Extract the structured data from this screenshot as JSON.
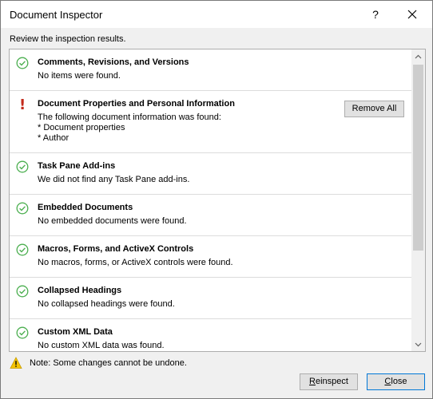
{
  "window": {
    "title": "Document Inspector",
    "help_glyph": "?"
  },
  "instruction": "Review the inspection results.",
  "results": [
    {
      "status": "ok",
      "title": "Comments, Revisions, and Versions",
      "description": "No items were found."
    },
    {
      "status": "found",
      "title": "Document Properties and Personal Information",
      "description": "The following document information was found:\n* Document properties\n* Author",
      "action_label": "Remove All"
    },
    {
      "status": "ok",
      "title": "Task Pane Add-ins",
      "description": "We did not find any Task Pane add-ins."
    },
    {
      "status": "ok",
      "title": "Embedded Documents",
      "description": "No embedded documents were found."
    },
    {
      "status": "ok",
      "title": "Macros, Forms, and ActiveX Controls",
      "description": "No macros, forms, or ActiveX controls were found."
    },
    {
      "status": "ok",
      "title": "Collapsed Headings",
      "description": "No collapsed headings were found."
    },
    {
      "status": "ok",
      "title": "Custom XML Data",
      "description": "No custom XML data was found."
    }
  ],
  "found_marker": "!",
  "note": "Note: Some changes cannot be undone.",
  "buttons": {
    "reinspect_first": "R",
    "reinspect_rest": "einspect",
    "close_first": "C",
    "close_rest": "lose"
  },
  "colors": {
    "ok_icon": "#4caf50",
    "found_icon": "#c42b1c",
    "warn_icon": "#f5c400",
    "accent": "#0078d7"
  },
  "icons": {
    "ok": "check-circle-icon",
    "found": "exclamation-icon",
    "note": "warning-triangle-icon"
  }
}
